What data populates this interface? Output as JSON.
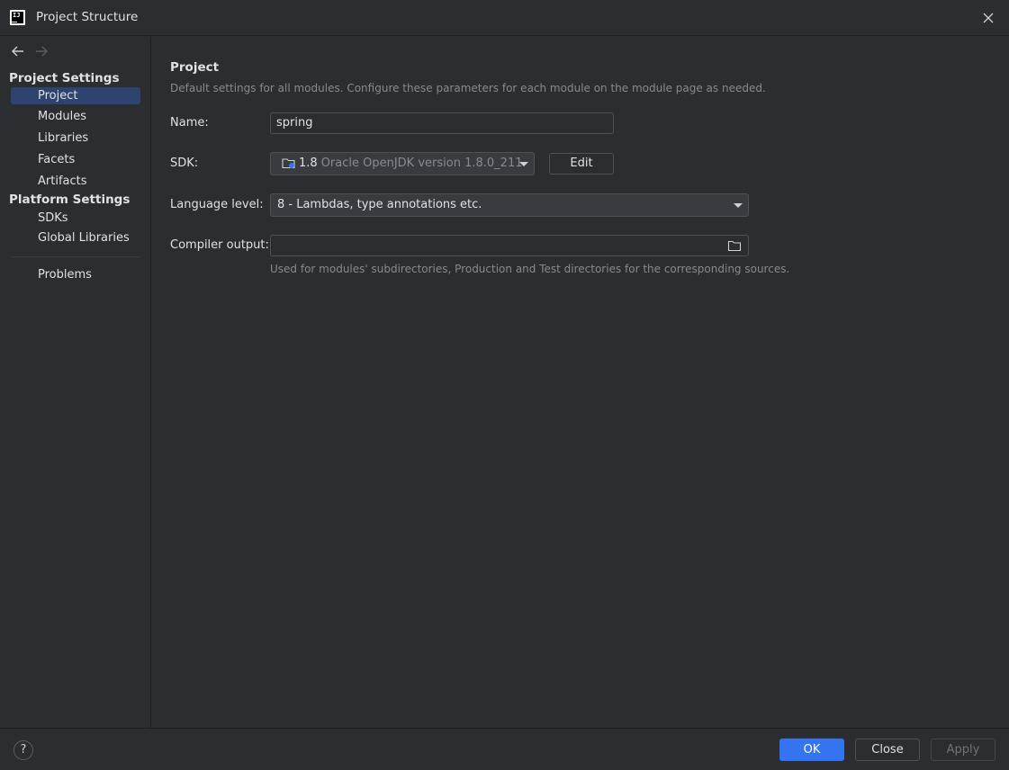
{
  "window": {
    "title": "Project Structure",
    "logo_text": "IJ"
  },
  "sidebar": {
    "groups": [
      {
        "header": "Project Settings",
        "items": [
          "Project",
          "Modules",
          "Libraries",
          "Facets",
          "Artifacts"
        ]
      },
      {
        "header": "Platform Settings",
        "items": [
          "SDKs",
          "Global Libraries"
        ]
      }
    ],
    "extra_item": "Problems",
    "selected": "Project"
  },
  "content": {
    "title": "Project",
    "description": "Default settings for all modules. Configure these parameters for each module on the module page as needed.",
    "name": {
      "label": "Name:",
      "value": "spring"
    },
    "sdk": {
      "label": "SDK:",
      "version": "1.8",
      "description": "Oracle OpenJDK version 1.8.0_211",
      "edit_label": "Edit"
    },
    "language_level": {
      "label": "Language level:",
      "value": "8 - Lambdas, type annotations etc."
    },
    "compiler_output": {
      "label": "Compiler output:",
      "value": "",
      "hint": "Used for modules' subdirectories, Production and Test directories for the corresponding sources."
    }
  },
  "footer": {
    "help_label": "?",
    "ok_label": "OK",
    "close_label": "Close",
    "apply_label": "Apply"
  },
  "colors": {
    "accent": "#3574f0",
    "selection": "#2e436e",
    "background": "#2b2d30"
  },
  "icons": [
    "intellij-logo-icon",
    "close-icon",
    "back-arrow-icon",
    "forward-arrow-icon",
    "folder-icon",
    "dropdown-arrow-icon",
    "help-icon"
  ]
}
